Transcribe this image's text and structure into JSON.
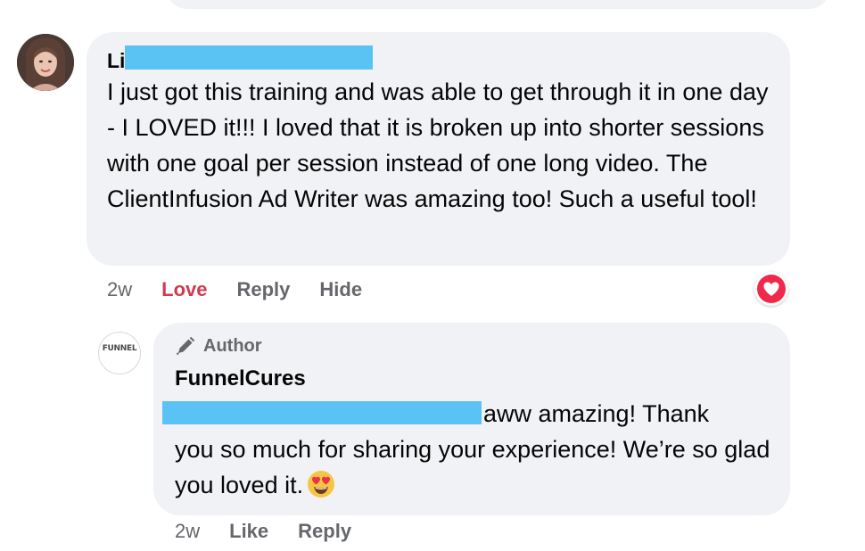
{
  "comment": {
    "author_visible": "Li",
    "text": "I just got this training and was able to get through it in one day - I LOVED it!!! I loved that it is broken up into shorter sessions with one goal per session instead of one long video. The ClientInfusion Ad Writer was amazing too! Such a useful tool!",
    "actions": {
      "time": "2w",
      "love": "Love",
      "reply": "Reply",
      "hide": "Hide"
    },
    "reaction_icon": "heart-icon",
    "colors": {
      "love": "#d3394e",
      "reaction": "#f0284a"
    }
  },
  "reply": {
    "avatar_text": "FUNNEL",
    "badge": "Author",
    "badge_icon": "pen-icon",
    "author": "FunnelCures",
    "text_line1": "aww amazing! Thank",
    "text_rest": "you so much for sharing your experience! We’re so glad you loved it.",
    "emoji_icon": "heart-eyes-emoji",
    "actions": {
      "time": "2w",
      "like": "Like",
      "reply": "Reply"
    }
  },
  "colors": {
    "bubble": "#f0f2f5",
    "redaction": "#5bc2f4",
    "secondary_text": "#65676b"
  }
}
